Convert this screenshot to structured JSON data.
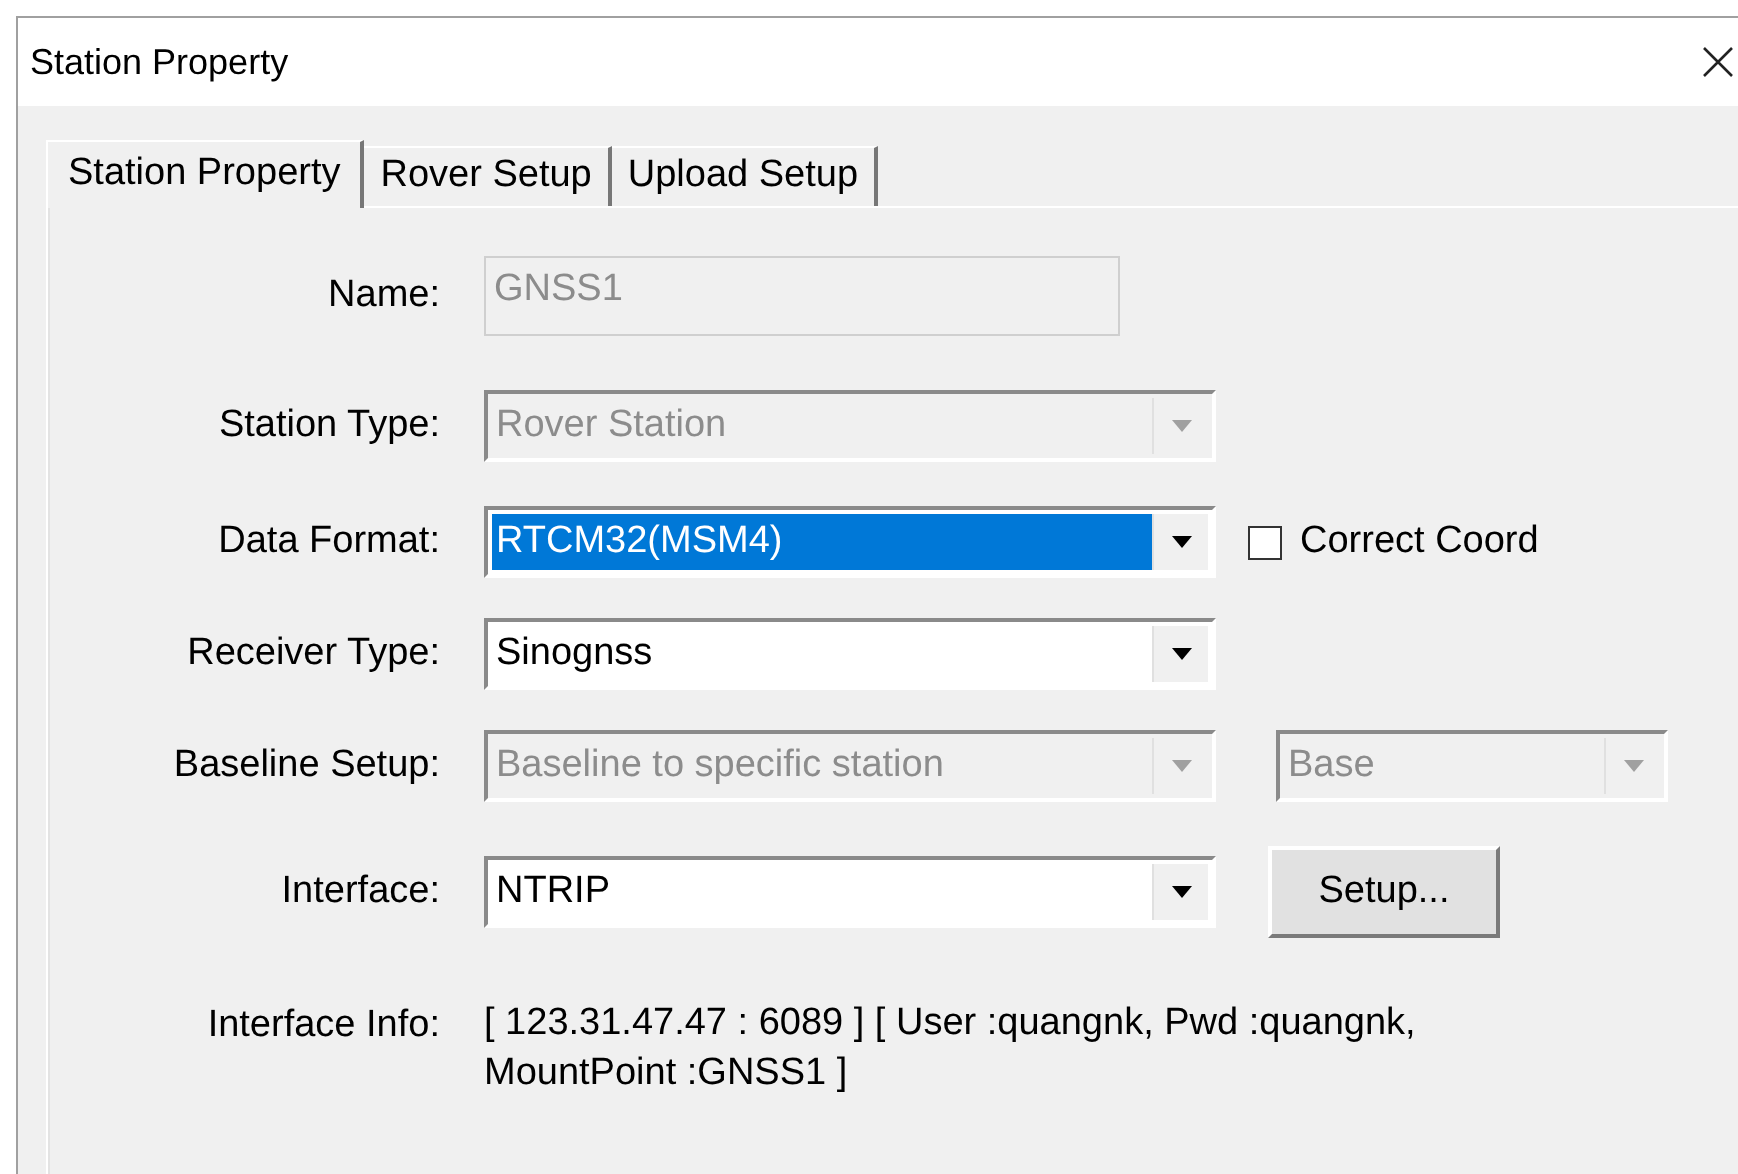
{
  "window": {
    "title": "Station Property"
  },
  "tabs": [
    {
      "label": "Station Property",
      "selected": true
    },
    {
      "label": "Rover Setup",
      "selected": false
    },
    {
      "label": "Upload Setup",
      "selected": false
    }
  ],
  "fields": [
    {
      "kind": "text",
      "label": "Name:",
      "value": "GNSS1",
      "disabled": true
    },
    {
      "kind": "dropdown",
      "label": "Station Type:",
      "value": "Rover Station",
      "disabled": true,
      "highlighted": false
    },
    {
      "kind": "dropdown",
      "label": "Data Format:",
      "value": "RTCM32(MSM4)",
      "disabled": false,
      "highlighted": true,
      "checkbox": {
        "label": "Correct Coord",
        "checked": false
      }
    },
    {
      "kind": "dropdown",
      "label": "Receiver Type:",
      "value": "Sinognss",
      "disabled": false,
      "highlighted": false
    },
    {
      "kind": "dropdown",
      "label": "Baseline Setup:",
      "value": "Baseline to specific station",
      "disabled": true,
      "highlighted": false,
      "extra_dropdown": {
        "value": "Base",
        "disabled": true
      }
    },
    {
      "kind": "dropdown",
      "label": "Interface:",
      "value": "NTRIP",
      "disabled": false,
      "highlighted": false,
      "button": "Setup..."
    },
    {
      "kind": "info",
      "label": "Interface Info:",
      "value": "[ 123.31.47.47 : 6089 ] [ User :quangnk, Pwd :quangnk, MountPoint :GNSS1 ]"
    }
  ]
}
